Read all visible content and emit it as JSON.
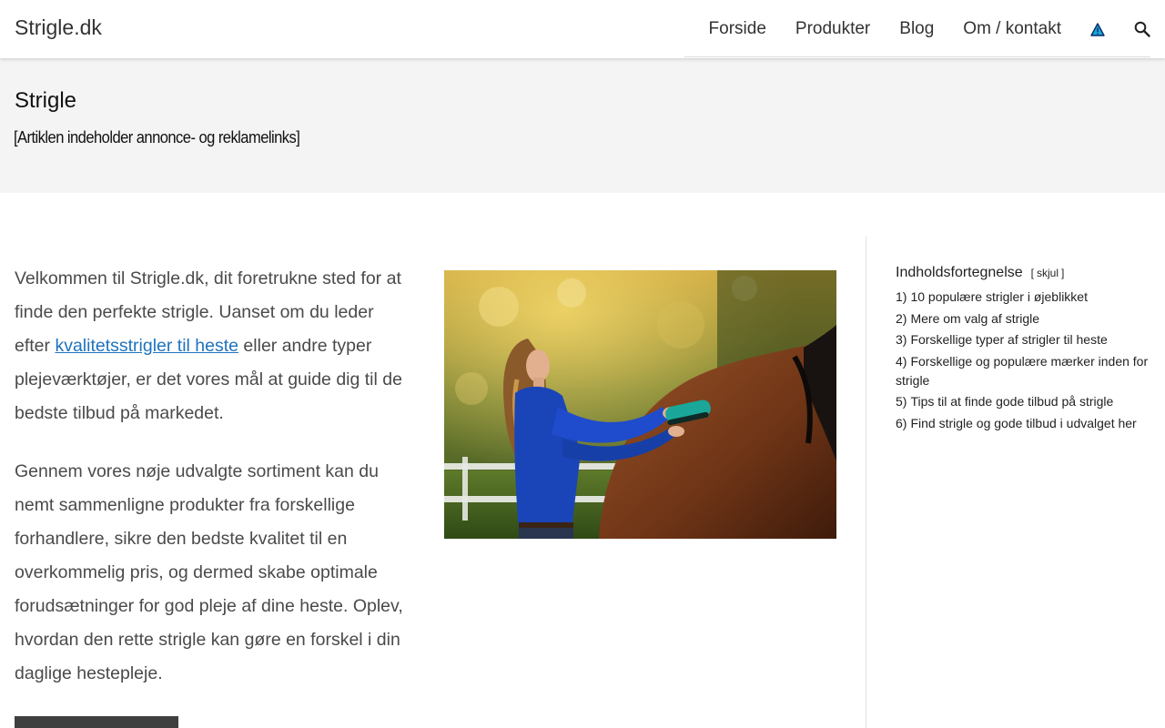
{
  "header": {
    "brand": "Strigle.dk",
    "nav": [
      {
        "label": "Forside"
      },
      {
        "label": "Produkter"
      },
      {
        "label": "Blog"
      },
      {
        "label": "Om / kontakt"
      }
    ],
    "icons": [
      "warning-triangle-icon",
      "search-icon"
    ]
  },
  "title_band": {
    "title": "Strigle",
    "disclaimer": "[Artiklen indeholder annonce- og reklamelinks]"
  },
  "main": {
    "intro": {
      "before_link": "Velkommen til Strigle.dk, dit foretrukne sted for at finde den perfekte strigle. Uanset om du leder efter ",
      "link_text": "kvalitetsstrigler til heste",
      "after_link": " eller andre typer plejeværktøjer, er det vores mål at guide dig til de bedste tilbud på markedet."
    },
    "paragraph2": "Gennem vores nøje udvalgte sortiment kan du nemt sammenligne produkter fra forskellige forhandlere, sikre den bedste kvalitet til en overkommelig pris, og dermed skabe optimale forudsætninger for god pleje af dine heste. Oplev, hvordan den rette strigle kan gøre en forskel i din daglige hestepleje."
  },
  "toc": {
    "title": "Indholdsfortegnelse",
    "toggle_open": "[",
    "toggle_label": "skjul",
    "toggle_close": "]",
    "items": [
      {
        "num": "1)",
        "label": "10 populære strigler i øjeblikket"
      },
      {
        "num": "2)",
        "label": "Mere om valg af strigle"
      },
      {
        "num": "3)",
        "label": "Forskellige typer af strigler til heste"
      },
      {
        "num": "4)",
        "label": "Forskellige og populære mærker inden for strigle"
      },
      {
        "num": "5)",
        "label": "Tips til at finde gode tilbud på strigle"
      },
      {
        "num": "6)",
        "label": "Find strigle og gode tilbud i udvalget her"
      }
    ]
  },
  "colors": {
    "link": "#1e73be",
    "title_band_bg": "#f4f4f4",
    "shirt": "#1a45b8",
    "horse": "#7a3d1c",
    "brush": "#1aa79a"
  }
}
